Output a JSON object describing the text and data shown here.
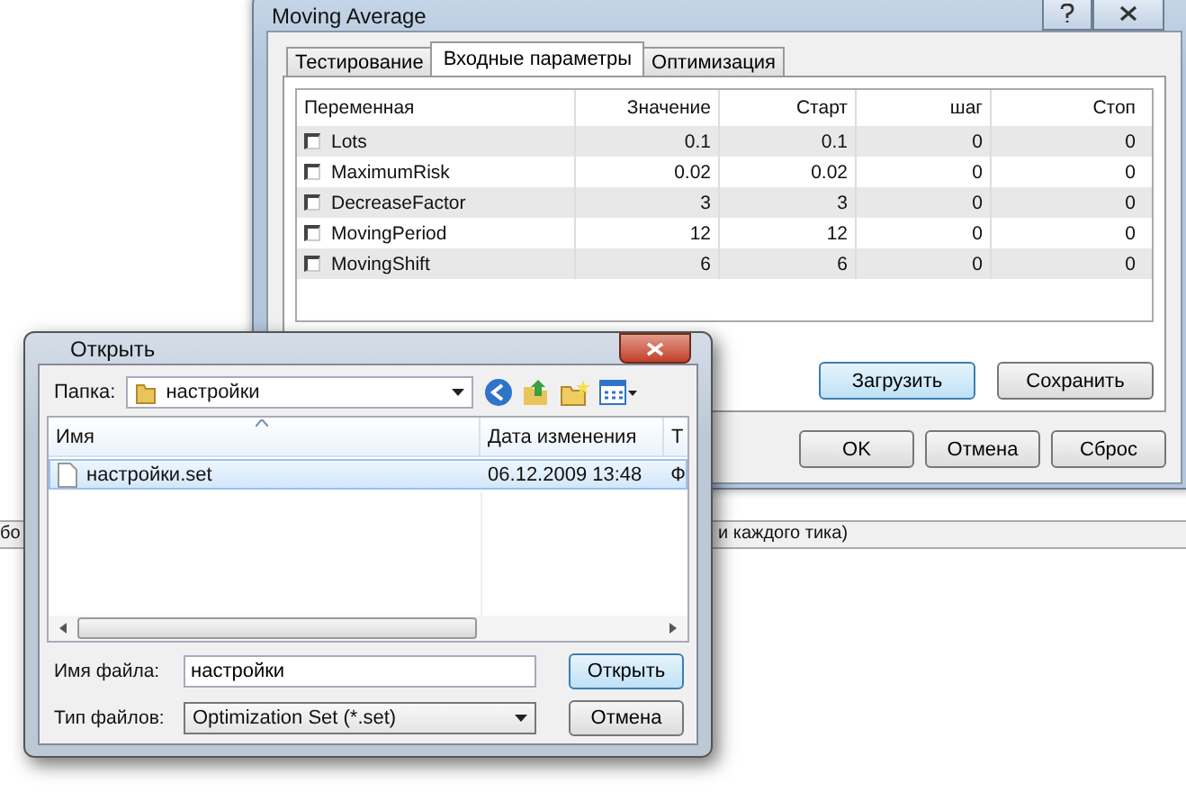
{
  "background": {
    "status_texts": [
      "бо",
      "и каждого тика)"
    ]
  },
  "settings_window": {
    "title": "Moving Average",
    "tabs": [
      {
        "label": "Тестирование",
        "selected": false
      },
      {
        "label": "Входные параметры",
        "selected": true
      },
      {
        "label": "Оптимизация",
        "selected": false
      }
    ],
    "table": {
      "columns": [
        "Переменная",
        "Значение",
        "Старт",
        "шаг",
        "Стоп"
      ],
      "rows": [
        {
          "checked": false,
          "cells": [
            "Lots",
            "0.1",
            "0.1",
            "0",
            "0"
          ]
        },
        {
          "checked": false,
          "cells": [
            "MaximumRisk",
            "0.02",
            "0.02",
            "0",
            "0"
          ]
        },
        {
          "checked": false,
          "cells": [
            "DecreaseFactor",
            "3",
            "3",
            "0",
            "0"
          ]
        },
        {
          "checked": false,
          "cells": [
            "MovingPeriod",
            "12",
            "12",
            "0",
            "0"
          ]
        },
        {
          "checked": false,
          "cells": [
            "MovingShift",
            "6",
            "6",
            "0",
            "0"
          ]
        }
      ]
    },
    "load_button": "Загрузить",
    "save_button": "Сохранить",
    "buttons": [
      "OK",
      "Отмена",
      "Сброс"
    ]
  },
  "open_dialog": {
    "title": "Открыть",
    "folder_label": "Папка:",
    "folder": "настройки",
    "file_list": {
      "columns": [
        "Имя",
        "Дата изменения",
        "Т"
      ],
      "rows": [
        {
          "name": "настройки.set",
          "date": "06.12.2009 13:48",
          "column_3": "Ф",
          "selected": true
        }
      ]
    },
    "file_name_label": "Имя файла:",
    "file_name": "настройки",
    "file_type_label": "Тип файлов:",
    "file_type": "Optimization Set (*.set)",
    "open_button": "Открыть",
    "cancel_button": "Отмена"
  }
}
